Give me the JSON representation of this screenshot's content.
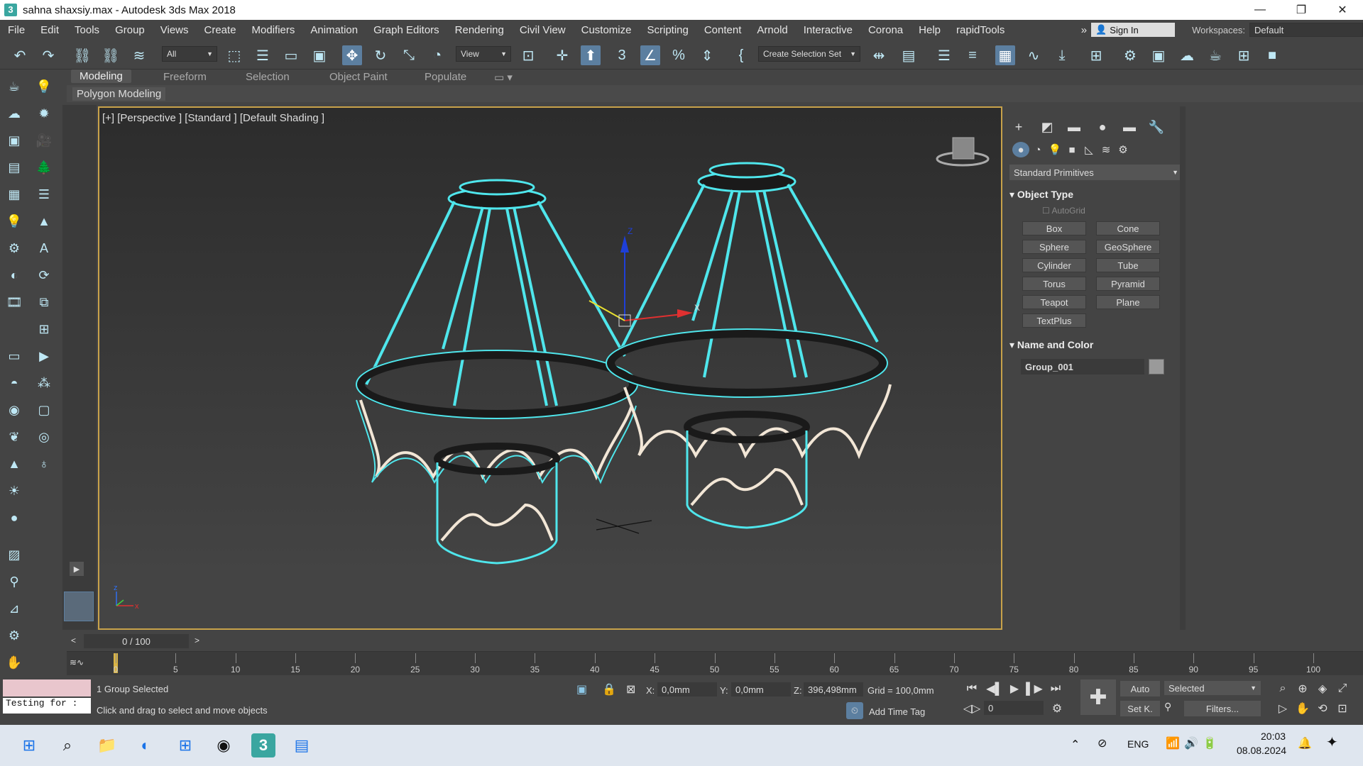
{
  "window": {
    "title": "sahna shaxsiy.max - Autodesk 3ds Max 2018",
    "app_icon": "3",
    "min": "—",
    "max": "❐",
    "close": "✕"
  },
  "menu": [
    "File",
    "Edit",
    "Tools",
    "Group",
    "Views",
    "Create",
    "Modifiers",
    "Animation",
    "Graph Editors",
    "Rendering",
    "Civil View",
    "Customize",
    "Scripting",
    "Content",
    "Arnold",
    "Interactive",
    "Corona",
    "Help",
    "rapidTools"
  ],
  "menu_right": {
    "overflow": "»",
    "signin": "Sign In",
    "workspaces_label": "Workspaces:",
    "workspace_value": "Default"
  },
  "toolbar": {
    "filter_select": "All",
    "view_select": "View",
    "selection_set": "Create Selection Set"
  },
  "ribbon": {
    "tabs": [
      "Modeling",
      "Freeform",
      "Selection",
      "Object Paint",
      "Populate"
    ],
    "active": "Modeling",
    "sub": "Polygon Modeling"
  },
  "viewport": {
    "label": "[+] [Perspective ] [Standard ] [Default Shading ]",
    "axis_x": "x",
    "axis_y": "y",
    "axis_z": "z",
    "gizmo_x": "X",
    "gizmo_y": "Y",
    "gizmo_z": "Z"
  },
  "command_panel": {
    "dropdown": "Standard Primitives",
    "object_type_title": "Object Type",
    "autogrid": "AutoGrid",
    "buttons": [
      "Box",
      "Cone",
      "Sphere",
      "GeoSphere",
      "Cylinder",
      "Tube",
      "Torus",
      "Pyramid",
      "Teapot",
      "Plane",
      "TextPlus"
    ],
    "name_color_title": "Name and Color",
    "object_name": "Group_001",
    "object_color": "#9a9a9a"
  },
  "timeline": {
    "frame_display": "0 / 100",
    "prev": "<",
    "next": ">",
    "ticks": [
      "0",
      "5",
      "10",
      "15",
      "20",
      "25",
      "30",
      "35",
      "40",
      "45",
      "50",
      "55",
      "60",
      "65",
      "70",
      "75",
      "80",
      "85",
      "90",
      "95",
      "100"
    ]
  },
  "status": {
    "maxscript_text": "Testing for :",
    "selection_info": "1 Group Selected",
    "prompt": "Click and drag to select and move objects",
    "x_label": "X:",
    "x_value": "0,0mm",
    "y_label": "Y:",
    "y_value": "0,0mm",
    "z_label": "Z:",
    "z_value": "396,498mm",
    "grid": "Grid = 100,0mm",
    "add_time_tag": "Add Time Tag",
    "frame_field": "0",
    "auto_key": "Auto",
    "set_key": "Set K.",
    "key_filter_select": "Selected",
    "filters": "Filters..."
  },
  "taskbar": {
    "lang": "ENG",
    "time": "20:03",
    "date": "08.08.2024"
  },
  "colors": {
    "wire": "#4fe6ec",
    "accent_active": "#5c7fa0",
    "viewport_border": "#c8a24a"
  }
}
